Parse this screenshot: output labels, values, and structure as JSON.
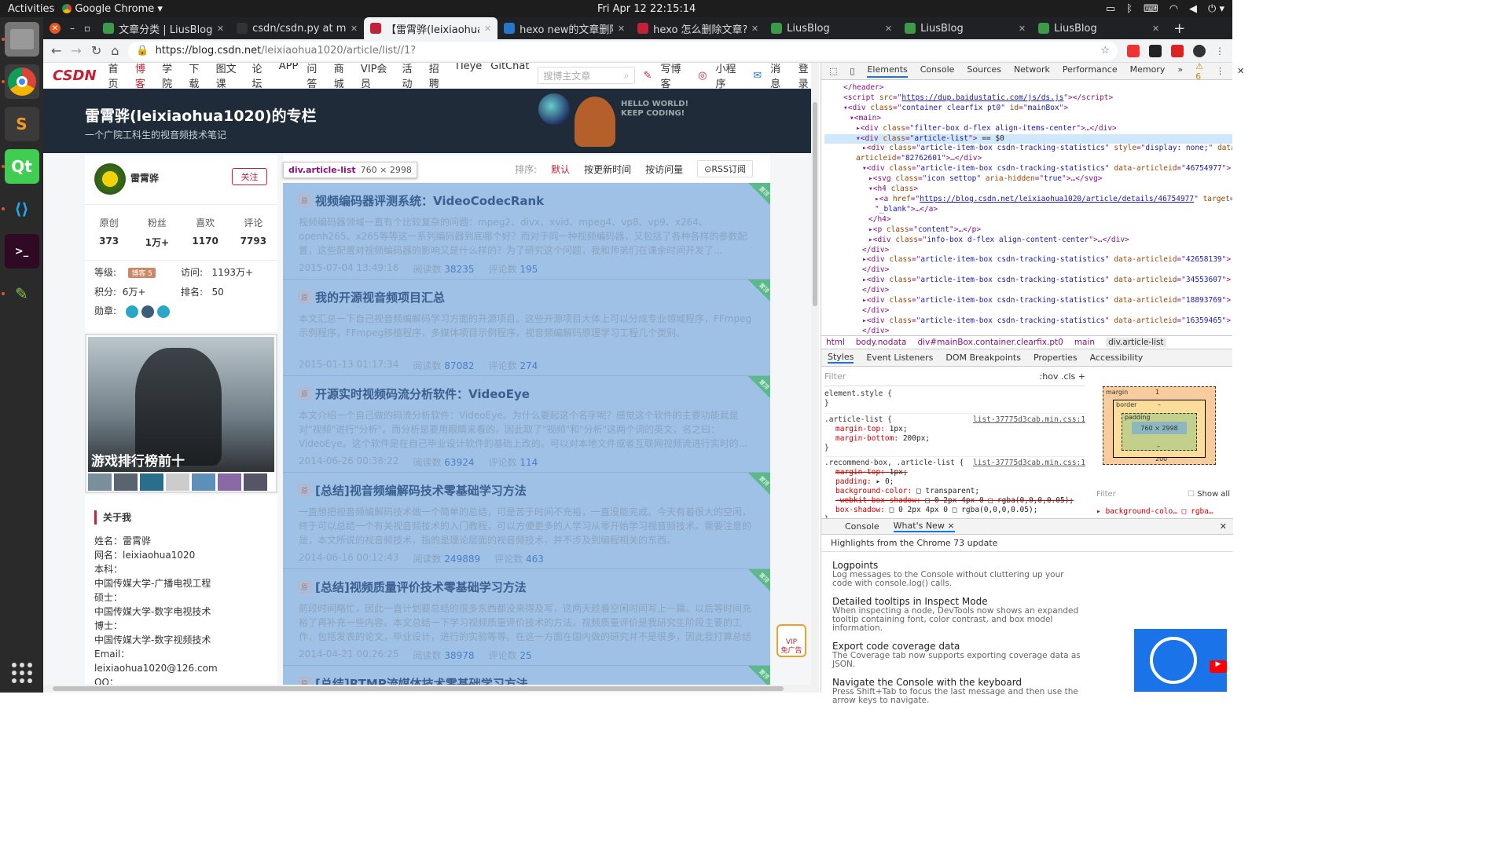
{
  "topbar": {
    "activities": "Activities",
    "app_name": "Google Chrome ▾",
    "clock": "Fri Apr 12  22:15:14"
  },
  "dock": {
    "items": [
      "files-icon",
      "chrome-icon",
      "sublime-icon",
      "qt-icon",
      "vscode-icon",
      "terminal-icon",
      "image-viewer-icon"
    ]
  },
  "chrome": {
    "tabs": [
      {
        "title": "文章分类 | LiusBlog",
        "favicon_color": "#3c9a48"
      },
      {
        "title": "csdn/csdn.py at mast",
        "favicon_color": "#333333"
      },
      {
        "title": "【雷霄骅(leixiaohua1",
        "favicon_color": "#c32136",
        "active": true
      },
      {
        "title": "hexo new的文章删除",
        "favicon_color": "#2677c9"
      },
      {
        "title": "hexo 怎么删除文章?",
        "favicon_color": "#c32136"
      },
      {
        "title": "LiusBlog",
        "favicon_color": "#3c9a48"
      },
      {
        "title": "LiusBlog",
        "favicon_color": "#3c9a48"
      },
      {
        "title": "LiusBlog",
        "favicon_color": "#3c9a48"
      }
    ],
    "url_host": "https://blog.csdn.net",
    "url_path": "/leixiaohua1020/article/list//1?"
  },
  "csdn": {
    "nav": [
      "首页",
      "博客",
      "学院",
      "下载",
      "图文课",
      "论坛",
      "APP",
      "问答",
      "商城",
      "VIP会员",
      "活动",
      "招聘",
      "ITeye",
      "GitChat"
    ],
    "search_placeholder": "搜博主文章",
    "right_nav": [
      "写博客",
      "小程序",
      "消息",
      "登录"
    ],
    "banner_title": "雷霄骅(leixiaohua1020)的专栏",
    "banner_sub": "一个广院工科生的视音频技术笔记",
    "banner_hello": "HELLO WORLD!",
    "banner_keep": "KEEP CODING!"
  },
  "profile": {
    "name": "雷霄骅",
    "follow": "关注",
    "stats": [
      {
        "label": "原创",
        "value": "373"
      },
      {
        "label": "粉丝",
        "value": "1万+"
      },
      {
        "label": "喜欢",
        "value": "1170"
      },
      {
        "label": "评论",
        "value": "7793"
      }
    ],
    "level_label": "等级:",
    "level_badge": "博客 5",
    "visits_label": "访问:",
    "visits": "1193万+",
    "points_label": "积分:",
    "points": "6万+",
    "rank_label": "排名:",
    "rank": "50",
    "medal_label": "勋章:"
  },
  "ad": {
    "caption": "游戏排行榜前十"
  },
  "about": {
    "heading": "关于我",
    "lines": [
      "姓名：雷霄骅",
      "网名：leixiaohua1020",
      "本科：",
      "中国传媒大学-广播电视工程",
      "硕士：",
      "中国传媒大学-数字电视技术",
      "博士：",
      "中国传媒大学-数字视频技术",
      "Email：",
      "leixiaohua1020@126.com",
      "QQ："
    ]
  },
  "list": {
    "sort_label": "排序:",
    "sort_default": "默认",
    "sort_time": "按更新时间",
    "sort_views": "按访问量",
    "rss": "RSS订阅",
    "tooltip_name": "div.article-list",
    "tooltip_size": "760 × 2998",
    "ribbon": "置顶",
    "tag": "原",
    "views_label": "阅读数",
    "comments_label": "评论数",
    "articles": [
      {
        "title": "视频编码器评测系统：VideoCodecRank",
        "desc": "视频编码器领域一直有个比较复杂的问题：mpeg2、divx、xvid、mpeg4、vp8、vp9、x264、openh265、x265等等这一系列编码器到底哪个好？而对于同一种视频编码器，又包括了各种各样的参数配置，这些配置对视频编码器的影响又是什么样的？为了研究这个问题，我和师弟们在课余时间开发了...",
        "date": "2015-07-04 13:49:16",
        "views": "38235",
        "comments": "195"
      },
      {
        "title": "我的开源视音频项目汇总",
        "desc": "本文汇总一下自己视音频编解码学习方面的开源项目。这些开源项目大体上可以分成专业领域程序，FFmpeg示例程序，FFmpeg移植程序，多媒体项目示例程序，视音频编解码原理学习工程几个类别。",
        "date": "2015-01-13 01:17:34",
        "views": "87082",
        "comments": "274"
      },
      {
        "title": "开源实时视频码流分析软件：VideoEye",
        "desc": "本文介绍一个自己做的码流分析软件：VideoEye。为什么要起这个名字呢？感觉这个软件的主要功能就是对\"视频\"进行\"分析\"。而分析是要用眼睛来看的，因此取了\"视频\"和\"分析\"这两个词的英文，名之曰：VideoEye。这个软件是在自己毕业设计软件的基础上改的。可以对本地文件或者互联网视频流进行实时的...",
        "date": "2014-06-26 00:38:22",
        "views": "63924",
        "comments": "114"
      },
      {
        "title": "[总结]视音频编解码技术零基础学习方法",
        "desc": "一直想把视音频编解码技术做一个简单的总结，可是苦于时间不充裕，一直没能完成。今天有着很大的空闲，终于可以总结一个有关视音频技术的入门教程，可以方便更多的人学习从零开始学习视音频技术。需要注意的是，本文所说的视音频技术，指的是理论层面的视音频技术，并不涉及到编程相关的东西。",
        "date": "2014-06-16 00:12:43",
        "views": "249889",
        "comments": "463"
      },
      {
        "title": "[总结]视频质量评价技术零基础学习方法",
        "desc": "前段时间略忙，因此一直计划要总结的很多东西都没来得及写，这两天趁着空闲时间写上一篇。以后等时间充裕了再补充一些内容。本文总结一下学习视频质量评价技术的方法。视频质量评价是我研究生阶段主要的工作，包括发表的论文，毕业设计，进行的实验等等。在这一方面在国内做的研究并不是很多，因此我打算总结一下学习的经...",
        "date": "2014-04-21 00:26:25",
        "views": "38978",
        "comments": "25"
      },
      {
        "title": "[总结]RTMP流媒体技术零基础学习方法",
        "desc": "",
        "date": "",
        "views": "",
        "comments": ""
      }
    ]
  },
  "vip": {
    "line1": "VIP",
    "line2": "免广告"
  },
  "devtools": {
    "tabs": [
      "Elements",
      "Console",
      "Sources",
      "Network",
      "Performance",
      "Memory",
      "»"
    ],
    "warn_count": "⚠ 6",
    "breadcrumbs": [
      "html",
      "body.nodata",
      "div#mainBox.container.clearfix.pt0",
      "main",
      "div.article-list"
    ],
    "subtabs": [
      "Styles",
      "Event Listeners",
      "DOM Breakpoints",
      "Properties",
      "Accessibility"
    ],
    "filter_placeholder": "Filter",
    "hov_cls": ":hov  .cls  +",
    "style_element": "element.style {",
    "style_close": "}",
    "rule1_selector": ".article-list {",
    "rule1_src": "list-37775d3cab.min.css:1",
    "rule1_props": [
      [
        "margin-top",
        "1px;"
      ],
      [
        "margin-bottom",
        "200px;"
      ]
    ],
    "rule2_selector": ".recommend-box, .article-list {",
    "rule2_src": "list-37775d3cab.min.css:1",
    "rule2_props": [
      [
        "margin-top",
        "1px;",
        "strike"
      ],
      [
        "padding",
        "▸ 0;",
        ""
      ],
      [
        "background-color",
        "□ transparent;",
        ""
      ],
      [
        "-webkit-box-shadow",
        "□ 0 2px 4px 0 □ rgba(0,0,0,0.05);",
        "strike"
      ],
      [
        "box-shadow",
        "□ 0 2px 4px 0 □ rgba(0,0,0,0.05);",
        ""
      ]
    ],
    "boxmodel": {
      "margin": "margin",
      "margin_top": "1",
      "border": "border",
      "border_val": "–",
      "padding": "padding",
      "padding_val": "–",
      "content": "760 × 2998",
      "margin_bottom": "200",
      "dash": "–"
    },
    "bm_filter": "Filter",
    "bm_showall": "Show all",
    "computed_first": "▸ background-colo…   □ rgba…",
    "drawer_tabs": [
      "Console",
      "What's New ×"
    ],
    "drawer_highlight": "Highlights from the Chrome 73 update",
    "whatsnew": [
      {
        "h": "Logpoints",
        "d": "Log messages to the Console without cluttering up your code with console.log() calls."
      },
      {
        "h": "Detailed tooltips in Inspect Mode",
        "d": "When inspecting a node, DevTools now shows an expanded tooltip containing font, color contrast, and box model information."
      },
      {
        "h": "Export code coverage data",
        "d": "The Coverage tab now supports exporting coverage data as JSON."
      },
      {
        "h": "Navigate the Console with the keyboard",
        "d": "Press Shift+Tab to focus the last message and then use the arrow keys to navigate."
      }
    ],
    "dom_lines": [
      {
        "indent": 3,
        "html": "&lt;/header&gt;",
        "sel": false
      },
      {
        "indent": 3,
        "html": "&lt;script <span class=an>src</span>=\"<span class=lk>https://dup.baidustatic.com/js/ds.js</span>\"&gt;&lt;/script&gt;",
        "sel": false
      },
      {
        "indent": 3,
        "html": "▾&lt;div <span class=an>class</span>=\"<span class=av>container clearfix pt0</span>\" <span class=an>id</span>=\"<span class=av>mainBox</span>\"&gt;",
        "sel": false
      },
      {
        "indent": 4,
        "html": "▾&lt;main&gt;",
        "sel": false
      },
      {
        "indent": 5,
        "html": "▸&lt;div <span class=an>class</span>=\"<span class=av>filter-box d-flex align-items-center</span>\"&gt;…&lt;/div&gt;",
        "sel": false
      },
      {
        "indent": 5,
        "html": "▾&lt;div <span class=an>class</span>=\"<span class=av>article-list</span>\"&gt; <span class=tx>== $0</span>",
        "sel": true
      },
      {
        "indent": 6,
        "html": "▸&lt;div <span class=an>class</span>=\"<span class=av>article-item-box csdn-tracking-statistics</span>\" <span class=an>style</span>=\"<span class=av>display: none;</span>\" <span class=an>data-</span>",
        "sel": false
      },
      {
        "indent": 5,
        "html": "<span class=an>articleid</span>=\"<span class=av>82762601</span>\"&gt;…&lt;/div&gt;",
        "sel": false
      },
      {
        "indent": 6,
        "html": "▾&lt;div <span class=an>class</span>=\"<span class=av>article-item-box csdn-tracking-statistics</span>\" <span class=an>data-articleid</span>=\"<span class=av>46754977</span>\"&gt;",
        "sel": false
      },
      {
        "indent": 7,
        "html": "▸&lt;svg <span class=an>class</span>=\"<span class=av>icon settop</span>\" <span class=an>aria-hidden</span>=\"<span class=av>true</span>\"&gt;…&lt;/svg&gt;",
        "sel": false
      },
      {
        "indent": 7,
        "html": "▾&lt;h4 <span class=an>class</span>&gt;",
        "sel": false
      },
      {
        "indent": 8,
        "html": "▸&lt;a <span class=an>href</span>=\"<span class=lk>https://blog.csdn.net/leixiaohua1020/article/details/46754977</span>\" <span class=an>target</span>=",
        "sel": false
      },
      {
        "indent": 8,
        "html": "\"<span class=av>_blank</span>\"&gt;…&lt;/a&gt;",
        "sel": false
      },
      {
        "indent": 7,
        "html": "&lt;/h4&gt;",
        "sel": false
      },
      {
        "indent": 7,
        "html": "▸&lt;p <span class=an>class</span>=\"<span class=av>content</span>\"&gt;…&lt;/p&gt;",
        "sel": false
      },
      {
        "indent": 7,
        "html": "▸&lt;div <span class=an>class</span>=\"<span class=av>info-box d-flex align-content-center</span>\"&gt;…&lt;/div&gt;",
        "sel": false
      },
      {
        "indent": 6,
        "html": "&lt;/div&gt;",
        "sel": false
      },
      {
        "indent": 6,
        "html": "▸&lt;div <span class=an>class</span>=\"<span class=av>article-item-box csdn-tracking-statistics</span>\" <span class=an>data-articleid</span>=\"<span class=av>42658139</span>\"&gt;",
        "sel": false
      },
      {
        "indent": 6,
        "html": "&lt;/div&gt;",
        "sel": false
      },
      {
        "indent": 6,
        "html": "▸&lt;div <span class=an>class</span>=\"<span class=av>article-item-box csdn-tracking-statistics</span>\" <span class=an>data-articleid</span>=\"<span class=av>34553607</span>\"&gt;",
        "sel": false
      },
      {
        "indent": 6,
        "html": "&lt;/div&gt;",
        "sel": false
      },
      {
        "indent": 6,
        "html": "▸&lt;div <span class=an>class</span>=\"<span class=av>article-item-box csdn-tracking-statistics</span>\" <span class=an>data-articleid</span>=\"<span class=av>18893769</span>\"&gt;",
        "sel": false
      },
      {
        "indent": 6,
        "html": "&lt;/div&gt;",
        "sel": false
      },
      {
        "indent": 6,
        "html": "▸&lt;div <span class=an>class</span>=\"<span class=av>article-item-box csdn-tracking-statistics</span>\" <span class=an>data-articleid</span>=\"<span class=av>16359465</span>\"&gt;",
        "sel": false
      },
      {
        "indent": 6,
        "html": "&lt;/div&gt;",
        "sel": false
      }
    ]
  }
}
